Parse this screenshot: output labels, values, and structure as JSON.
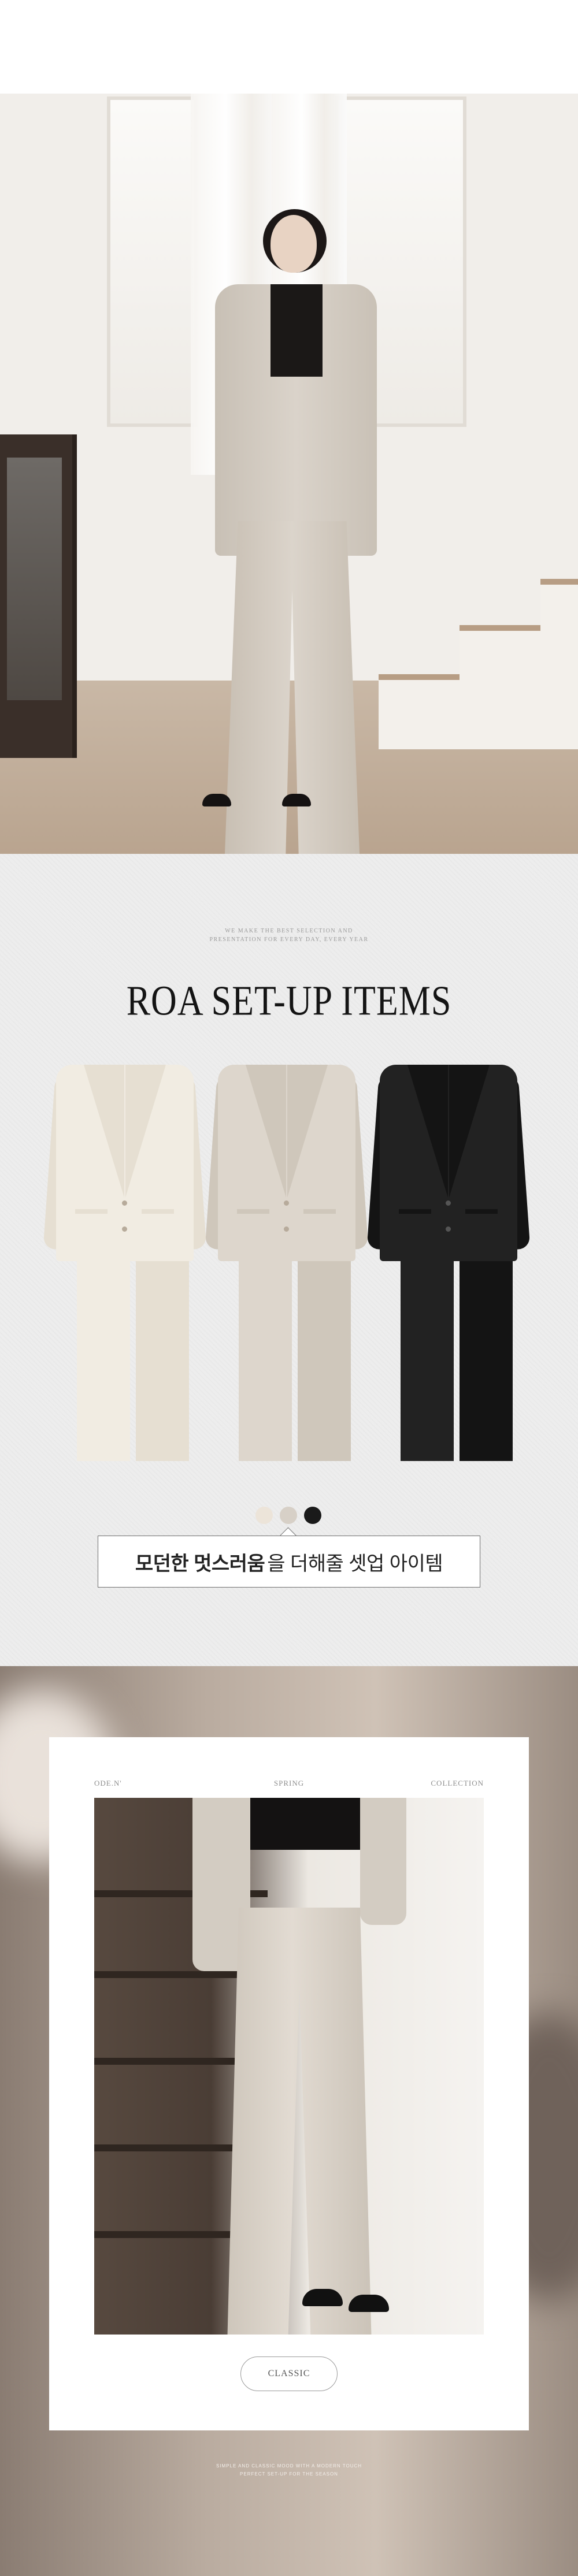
{
  "colors": {
    "page_bg": "#ffffff",
    "collection_bg": "#ededed",
    "heading_text": "#141414",
    "box_border": "#6d6d6d"
  },
  "collection": {
    "caption_line_1": "WE MAKE THE BEST SELECTION AND",
    "caption_line_2": "PRESENTATION FOR EVERY DAY, EVERY YEAR",
    "heading": "ROA SET-UP ITEMS",
    "products": [
      {
        "name": "ivory-suit",
        "color": "#f1ece2",
        "trim": "#e6dfd2"
      },
      {
        "name": "beige-suit",
        "color": "#ddd6cc",
        "trim": "#cfc7bb"
      },
      {
        "name": "black-suit",
        "color": "#222222",
        "trim": "#141414"
      }
    ],
    "swatches": [
      {
        "name": "ivory",
        "color": "#ece4d9"
      },
      {
        "name": "beige",
        "color": "#d7d0c7"
      },
      {
        "name": "black",
        "color": "#1a1a1a"
      }
    ],
    "slogan_bold": "모던한 멋스러움",
    "slogan_rest": "을 더해줄 셋업 아이템"
  },
  "lookbook": {
    "label_left": "ODE.N'",
    "label_center": "SPRING",
    "label_right": "COLLECTION",
    "pill": "CLASSIC",
    "footer_line_1": "SIMPLE AND CLASSIC MOOD WITH A MODERN TOUCH",
    "footer_line_2": "PERFECT SET-UP FOR THE SEASON"
  }
}
